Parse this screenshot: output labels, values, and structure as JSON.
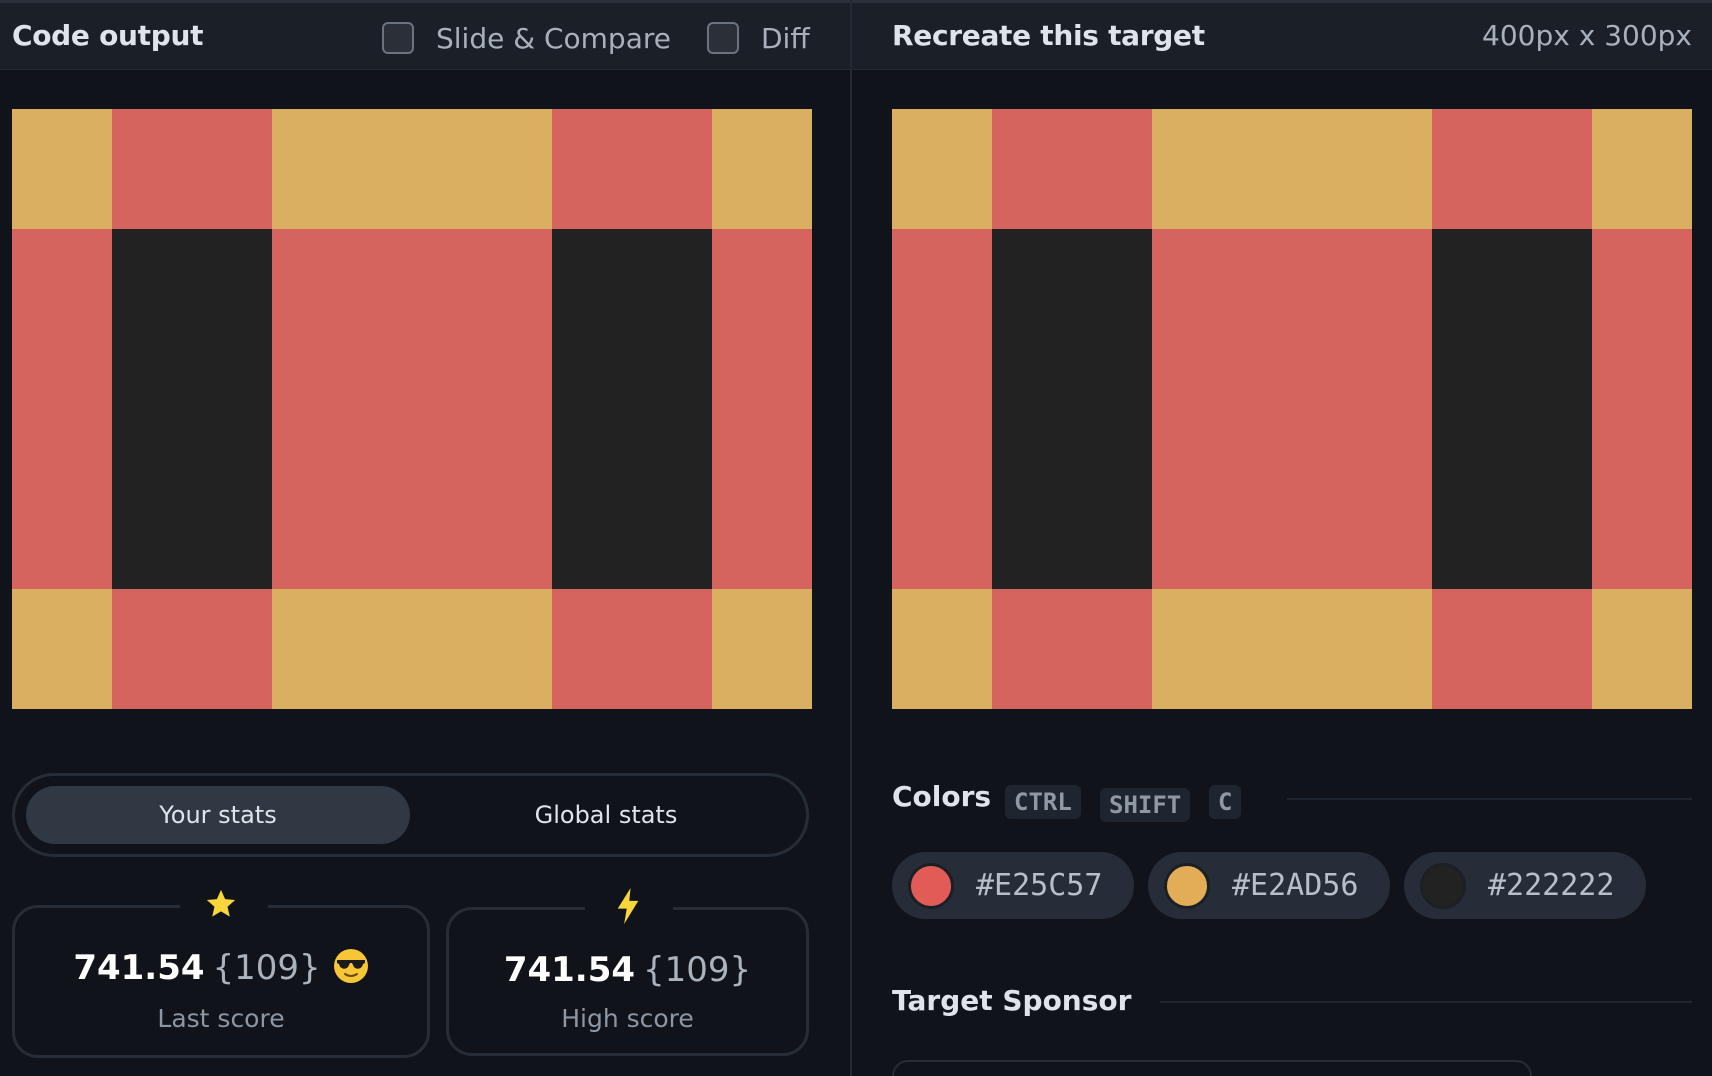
{
  "code_output": {
    "title": "Code output",
    "slide_compare_label": "Slide & Compare",
    "diff_label": "Diff"
  },
  "target": {
    "title": "Recreate this target",
    "dimensions": "400px x 300px"
  },
  "stats": {
    "tabs": [
      "Your stats",
      "Global stats"
    ],
    "active_tab": "Your stats",
    "last": {
      "icon": "star-icon",
      "value": "741.54",
      "count": "{109}",
      "emoji": "sunglasses-emoji-icon",
      "label": "Last score"
    },
    "high": {
      "icon": "lightning-icon",
      "value": "741.54",
      "count": "{109}",
      "label": "High score"
    }
  },
  "colors": {
    "heading": "Colors",
    "shortcut": [
      "CTRL",
      "SHIFT",
      "C"
    ],
    "swatches": [
      {
        "hex": "#E25C57",
        "display": "#E25C57"
      },
      {
        "hex": "#E2AD56",
        "display": "#E2AD56"
      },
      {
        "hex": "#222222",
        "display": "#222222"
      }
    ]
  },
  "sponsor": {
    "heading": "Target Sponsor"
  },
  "art": {
    "colors": {
      "red": "#D5645E",
      "yellow": "#DAAF62",
      "dark": "#222222"
    }
  }
}
